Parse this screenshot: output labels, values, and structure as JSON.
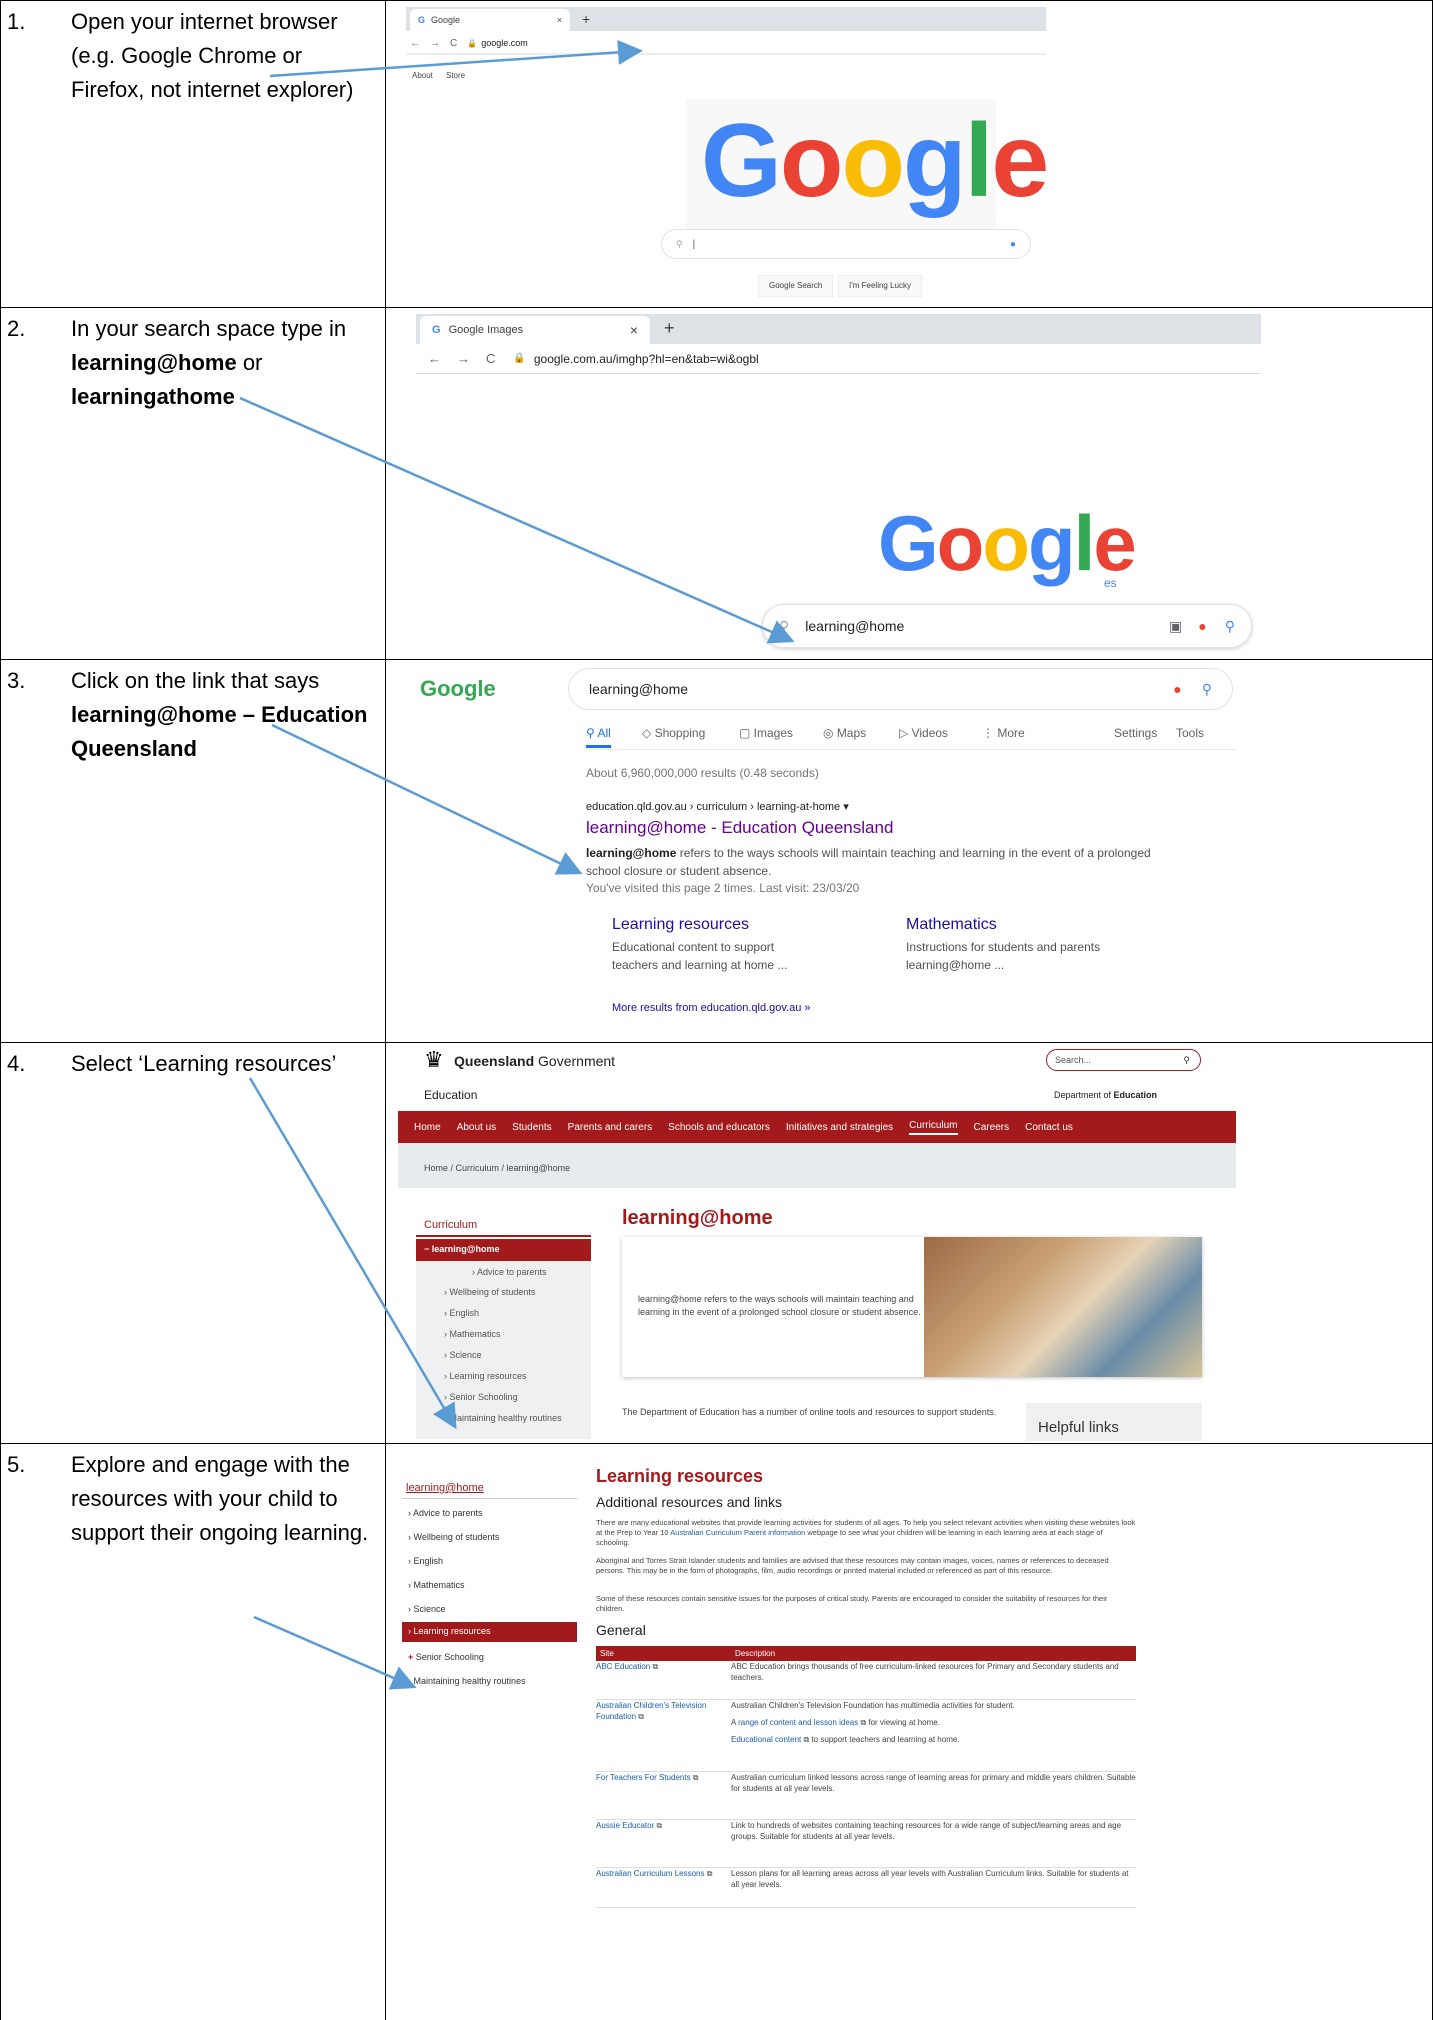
{
  "steps": [
    {
      "num": "1.",
      "pre": "Open your internet browser (e.g. Google Chrome or Firefox, not internet explorer)"
    },
    {
      "num": "2.",
      "pre": "In your search space type in ",
      "b1": "learning@home",
      "mid": "  or ",
      "b2": "learningathome"
    },
    {
      "num": "3.",
      "pre": "Click on the link that says ",
      "b1": "learning@home – Education Queensland"
    },
    {
      "num": "4.",
      "pre": "Select ‘Learning resources’"
    },
    {
      "num": "5.",
      "pre": "Explore and engage with the resources with your child to support their ongoing learning."
    }
  ],
  "shot1": {
    "tab_title": "Google",
    "tab_close": "×",
    "new_tab": "+",
    "url": "google.com",
    "top_links": [
      "About",
      "Store"
    ],
    "logo": [
      "G",
      "o",
      "o",
      "g",
      "l",
      "e"
    ],
    "search_value": "|",
    "btn_search": "Google Search",
    "btn_lucky": "I'm Feeling Lucky"
  },
  "shot2": {
    "tab_title": "Google Images",
    "tab_close": "×",
    "new_tab": "+",
    "url": "google.com.au/imghp?hl=en&tab=wi&ogbl",
    "logo": [
      "G",
      "o",
      "o",
      "g",
      "l",
      "e"
    ],
    "logo_sub": "es",
    "search_value": "learning@home"
  },
  "shot3": {
    "logo": "Google",
    "search_value": "learning@home",
    "tabs": [
      "All",
      "Shopping",
      "Images",
      "Maps",
      "Videos",
      "More"
    ],
    "tab_right": [
      "Settings",
      "Tools"
    ],
    "stats": "About 6,960,000,000 results (0.48 seconds)",
    "breadcrumb": "education.qld.gov.au › curriculum › learning-at-home ▾",
    "result_title": "learning@home - Education Queensland",
    "snippet_b": "learning@home",
    "snippet": " refers to the ways schools will maintain teaching and learning in the event of a prolonged school closure or student absence.",
    "visited": "You've visited this page 2 times. Last visit: 23/03/20",
    "sub1_title": "Learning resources",
    "sub1_desc": "Educational content to support teachers and learning at home ...",
    "sub2_title": "Mathematics",
    "sub2_desc": "Instructions for students and parents learning@home ...",
    "more": "More results from education.qld.gov.au »"
  },
  "shot4": {
    "brand_bold": "Queensland",
    "brand_rest": " Government",
    "search_placeholder": "Search...",
    "section": "Education",
    "dept_pre": "Department of ",
    "dept_bold": "Education",
    "nav": [
      "Home",
      "About us",
      "Students",
      "Parents and carers",
      "Schools and educators",
      "Initiatives and strategies",
      "Curriculum",
      "Careers",
      "Contact us"
    ],
    "breadcrumb": "Home  /  Curriculum  /  learning@home",
    "side_title": "Curriculum",
    "side_active": "learning@home",
    "side_items": [
      "Advice to parents",
      "Wellbeing of students",
      "English",
      "Mathematics",
      "Science",
      "Learning resources",
      "Senior Schooling",
      "Maintaining healthy routines"
    ],
    "page_title": "learning@home",
    "intro": "learning@home refers to the ways schools will maintain teaching and learning in the event of a prolonged school closure or student absence.",
    "body": "The Department of Education has a number of online tools and resources to support students.",
    "helpful": "Helpful links"
  },
  "shot5": {
    "side_title": "learning@home",
    "side_items": [
      "Advice to parents",
      "Wellbeing of students",
      "English",
      "Mathematics",
      "Science",
      "Learning resources",
      "Senior Schooling",
      "Maintaining healthy routines"
    ],
    "title": "Learning resources",
    "subtitle": "Additional resources and links",
    "p1a": "There are many educational websites that provide learning activities for students of all ages. To help you select relevant activities when visiting these websites look at the Prep to Year 10 ",
    "p1link": "Australian Curriculum Parent information",
    "p1b": " webpage to see what your children will be learning in each learning area at each stage of schooling.",
    "p2": "Aboriginal and Torres Strait Islander students and families are advised that these resources may contain images, voices, names or references to deceased persons. This may be in the form of photographs, film, audio recordings or printed material included or referenced as part of this resource.",
    "p3": "Some of these resources contain sensitive issues for the purposes of critical study. Parents are encouraged to consider the suitability of resources for their children.",
    "general": "General",
    "col_site": "Site",
    "col_desc": "Description",
    "rows": [
      {
        "site": "ABC Education",
        "desc": "ABC Education brings thousands of free curriculum-linked resources for Primary and Secondary students and teachers."
      },
      {
        "site": "Australian Children's Television Foundation",
        "desc": "Australian Children's Television Foundation has multimedia activities for student.",
        "l1": "range of content and lesson ideas",
        "l1pre": "A ",
        "l1post": " for viewing at home.",
        "l2": "Educational content",
        "l2post": " to support teachers and learning at home."
      },
      {
        "site": "For Teachers For Students",
        "desc": "Australian curriculum linked lessons across range of learning areas for primary and middle years children. Suitable for students at all year levels."
      },
      {
        "site": "Aussie Educator",
        "desc": "Link to hundreds of websites containing teaching resources for a wide range of subject/learning areas and age groups. Suitable for students at all year levels."
      },
      {
        "site": "Australian Curriculum Lessons",
        "desc": "Lesson plans for all learning areas across all year levels with Australian Curriculum links. Suitable for students at all year levels."
      }
    ]
  },
  "colors": {
    "arrow": "#5b9bd5",
    "qld_red": "#a31a1d",
    "link": "#1a0dab"
  }
}
